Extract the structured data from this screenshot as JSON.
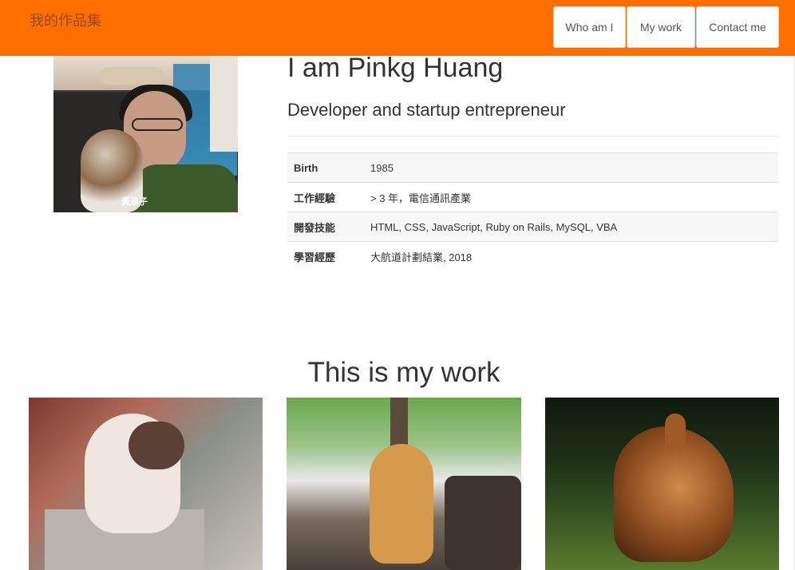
{
  "navbar": {
    "brand": "我的作品集",
    "links": [
      "Who am I",
      "My work",
      "Contact me"
    ]
  },
  "profile": {
    "caption": "黃浪子"
  },
  "intro": {
    "name": "I am Pinkg Huang",
    "subtitle": "Developer and startup entrepreneur"
  },
  "info": [
    {
      "label": "Birth",
      "value": "1985"
    },
    {
      "label": "工作經驗",
      "value": "> 3 年，電信通訊產業"
    },
    {
      "label": "開發技能",
      "value": "HTML, CSS, JavaScript, Ruby on Rails, MySQL, VBA"
    },
    {
      "label": "學習經歷",
      "value": "大航道計劃結業, 2018"
    }
  ],
  "work": {
    "title": "This is my work"
  },
  "colors": {
    "navbar_bg": "#ff6f00",
    "brand_text": "#9a4a12"
  }
}
